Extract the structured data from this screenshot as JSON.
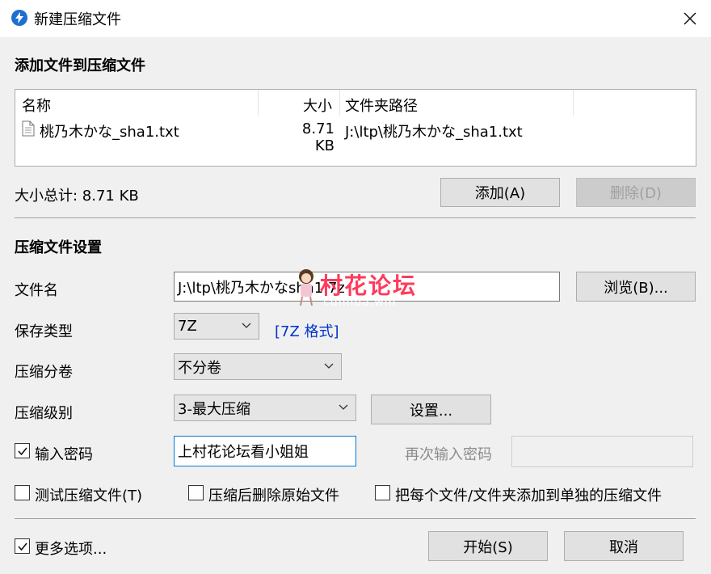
{
  "window": {
    "title": "新建压缩文件",
    "accent": "#1f6fd1"
  },
  "add_section": {
    "title": "添加文件到压缩文件",
    "columns": [
      "名称",
      "大小",
      "文件夹路径"
    ],
    "files": [
      {
        "name": "桃乃木かな_sha1.txt",
        "size": "8.71 KB",
        "path": "J:\\ltp\\桃乃木かな_sha1.txt"
      }
    ],
    "total_label": "大小总计: 8.71 KB",
    "add_button": "添加(A)",
    "delete_button": "删除(D)"
  },
  "settings": {
    "title": "压缩文件设置",
    "filename_label": "文件名",
    "filename_value": "J:\\ltp\\桃乃木かなsha1.7z",
    "browse_button": "浏览(B)...",
    "save_type_label": "保存类型",
    "save_type_value": "7Z",
    "format_link": "[7Z 格式]",
    "split_label": "压缩分卷",
    "split_value": "不分卷",
    "level_label": "压缩级别",
    "level_value": "3-最大压缩",
    "level_settings_button": "设置...",
    "password_label": "输入密码",
    "password_checked": true,
    "password_value": "上村花论坛看小姐姐",
    "repeat_password_label": "再次输入密码",
    "repeat_password_value": "",
    "test_label": "测试压缩文件(T)",
    "test_checked": false,
    "delete_after_label": "压缩后删除原始文件",
    "delete_after_checked": false,
    "separate_label": "把每个文件/文件夹添加到单独的压缩文件",
    "separate_checked": false
  },
  "footer": {
    "more_options_label": "更多选项...",
    "more_options_checked": true,
    "start_button": "开始(S)",
    "cancel_button": "取消"
  },
  "watermark": {
    "text": "村花论坛",
    "sub": "cunhua.win",
    "color": "#ff3b5c"
  }
}
